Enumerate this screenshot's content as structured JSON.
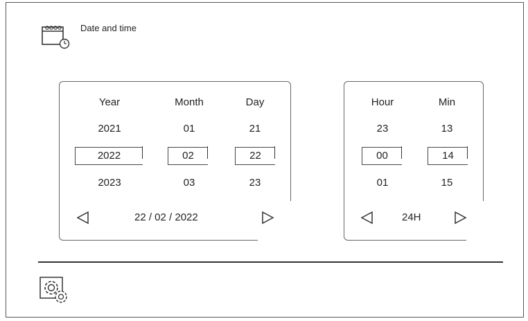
{
  "header": {
    "title": "Date and time",
    "icon": "calendar-clock-icon"
  },
  "date": {
    "columns": [
      {
        "label": "Year",
        "prev": "2021",
        "selected": "2022",
        "next": "2023"
      },
      {
        "label": "Month",
        "prev": "01",
        "selected": "02",
        "next": "03"
      },
      {
        "label": "Day",
        "prev": "21",
        "selected": "22",
        "next": "23"
      }
    ],
    "display": "22 / 02 / 2022",
    "left_arrow_icon": "triangle-left-icon",
    "right_arrow_icon": "triangle-right-icon"
  },
  "time": {
    "columns": [
      {
        "label": "Hour",
        "prev": "23",
        "selected": "00",
        "next": "01"
      },
      {
        "label": "Min",
        "prev": "13",
        "selected": "14",
        "next": "15"
      }
    ],
    "format": "24H",
    "left_arrow_icon": "triangle-left-icon",
    "right_arrow_icon": "triangle-right-icon"
  },
  "footer": {
    "settings_icon": "settings-gear-icon"
  }
}
